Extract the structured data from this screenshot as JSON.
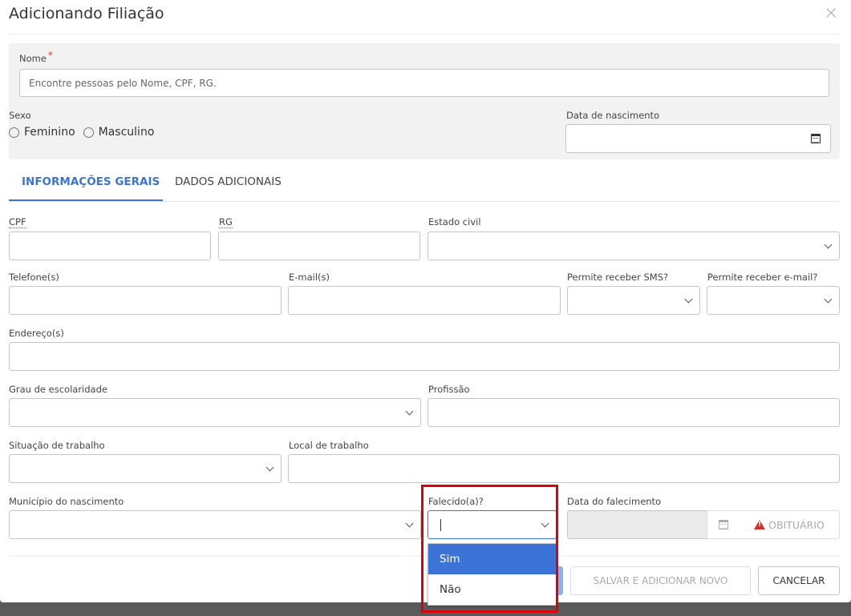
{
  "dialog": {
    "title": "Adicionando Filiação",
    "close_icon": "×"
  },
  "person": {
    "name_label": "Nome",
    "required_mark": "*",
    "name_placeholder": "Encontre pessoas pelo Nome, CPF, RG.",
    "sex_label": "Sexo",
    "sex_options": [
      "Feminino",
      "Masculino"
    ],
    "birth_label": "Data de nascimento"
  },
  "tabs": [
    {
      "label": "INFORMAÇÕES GERAIS",
      "active": true
    },
    {
      "label": "DADOS ADICIONAIS",
      "active": false
    }
  ],
  "form": {
    "cpf_label": "CPF",
    "rg_label": "RG",
    "estado_civil_label": "Estado civil",
    "telefone_label": "Telefone(s)",
    "email_label": "E-mail(s)",
    "sms_label": "Permite receber SMS?",
    "permite_email_label": "Permite receber e-mail?",
    "endereco_label": "Endereço(s)",
    "escolaridade_label": "Grau de escolaridade",
    "profissao_label": "Profissão",
    "situacao_label": "Situação de trabalho",
    "local_label": "Local de trabalho",
    "municipio_label": "Município do nascimento",
    "falecido_label": "Falecido(a)?",
    "data_falecimento_label": "Data do falecimento",
    "obituario_label": "OBITUÁRIO"
  },
  "falecido_dropdown": {
    "options": [
      "Sim",
      "Não"
    ],
    "highlighted": "Sim"
  },
  "footer": {
    "save_new_label": "SALVAR E ADICIONAR NOVO",
    "cancel_label": "CANCELAR"
  },
  "colors": {
    "accent": "#3b73d6",
    "required": "#e53935",
    "highlight_box": "#e0000a",
    "warning": "#d32f2f"
  }
}
